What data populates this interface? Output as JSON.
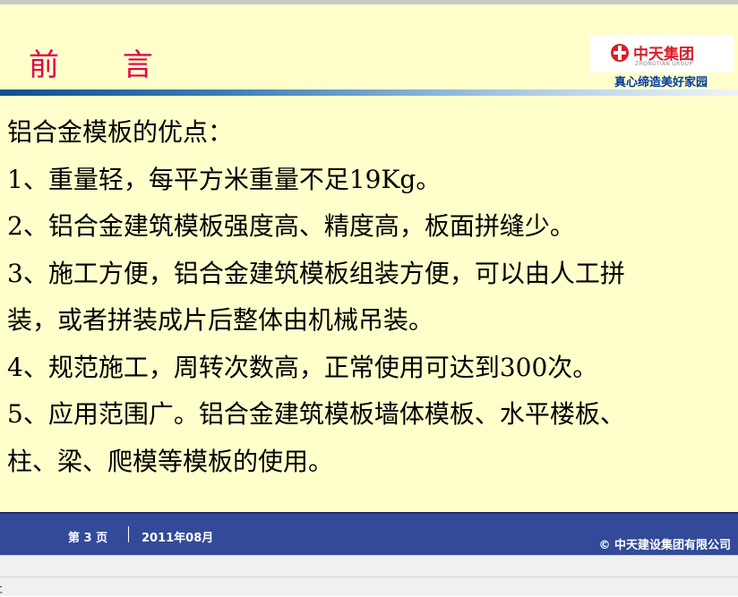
{
  "slide": {
    "title": "前 言",
    "logo": {
      "name": "中天集团",
      "sub": "ZHONGTIAN GROUP",
      "slogan": "真心缔造美好家园"
    },
    "content_lines": [
      "铝合金模板的优点：",
      "1、重量轻，每平方米重量不足19Kg。",
      "2、铝合金建筑模板强度高、精度高，板面拼缝少。",
      "3、施工方便，铝合金建筑模板组装方便，可以由人工拼",
      "装，或者拼装成片后整体由机械吊装。",
      "4、规范施工，周转次数高，正常使用可达到300次。",
      "5、应用范围广。铝合金建筑模板墙体模板、水平楼板、",
      "柱、梁、爬模等模板的使用。"
    ],
    "footer": {
      "page": "第 3 页",
      "date": "2011年08月",
      "copyright": "© 中天建设集团有限公司"
    }
  },
  "status": {
    "char": "ﾆ"
  },
  "colors": {
    "title": "#e0004d",
    "footer_bg": "#334a99",
    "slide_bg": "#ffffcc",
    "slogan": "#003aa0",
    "logo_red": "#d81e2a"
  }
}
